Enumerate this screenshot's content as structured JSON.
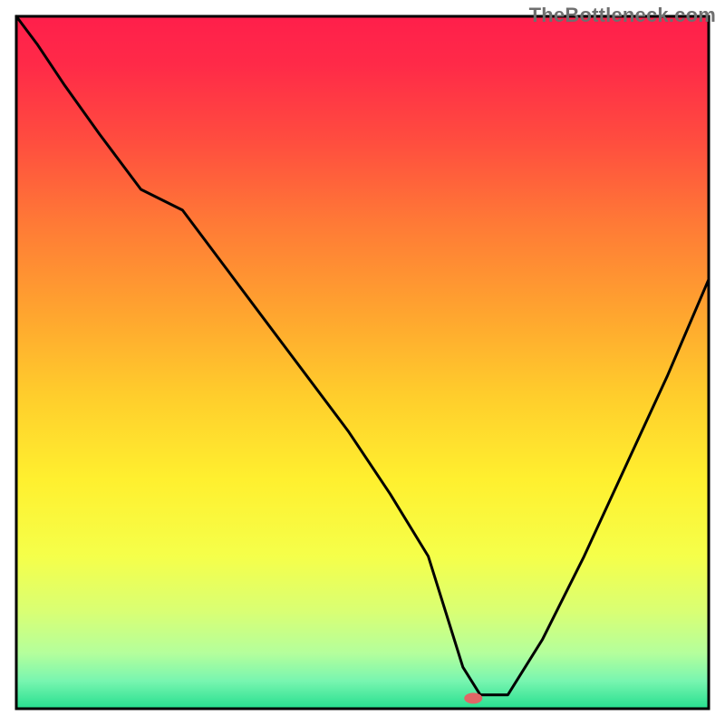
{
  "watermark": "TheBottleneck.com",
  "chart_data": {
    "type": "line",
    "title": "",
    "xlabel": "",
    "ylabel": "",
    "xlim": [
      0,
      100
    ],
    "ylim": [
      0,
      100
    ],
    "grid": false,
    "legend": false,
    "series": [
      {
        "name": "bottleneck-curve",
        "x": [
          0,
          3,
          7,
          12,
          18,
          24,
          30,
          36,
          42,
          48,
          54,
          59.5,
          62,
          64.5,
          67,
          68,
          71,
          76,
          82,
          88,
          94,
          100
        ],
        "y": [
          100,
          96,
          90,
          83,
          75,
          72,
          64,
          56,
          48,
          40,
          31,
          22,
          14,
          6,
          2,
          2,
          2,
          10,
          22,
          35,
          48,
          62
        ]
      }
    ],
    "marker": {
      "name": "optimal-marker",
      "x": 66,
      "y": 1.5,
      "color": "#e06666",
      "rx": 10,
      "ry": 6
    },
    "background_gradient": {
      "stops": [
        {
          "offset": 0.0,
          "color": "#ff1f4b"
        },
        {
          "offset": 0.07,
          "color": "#ff2a48"
        },
        {
          "offset": 0.18,
          "color": "#ff4d3f"
        },
        {
          "offset": 0.3,
          "color": "#ff7a36"
        },
        {
          "offset": 0.43,
          "color": "#ffa52f"
        },
        {
          "offset": 0.55,
          "color": "#ffce2c"
        },
        {
          "offset": 0.67,
          "color": "#fff02f"
        },
        {
          "offset": 0.78,
          "color": "#f5ff4a"
        },
        {
          "offset": 0.86,
          "color": "#d9ff74"
        },
        {
          "offset": 0.92,
          "color": "#b4ff9c"
        },
        {
          "offset": 0.96,
          "color": "#78f5b0"
        },
        {
          "offset": 1.0,
          "color": "#26df8f"
        }
      ]
    },
    "frame": {
      "stroke": "#000000",
      "width": 3
    },
    "curve_style": {
      "stroke": "#000000",
      "width": 3
    }
  }
}
